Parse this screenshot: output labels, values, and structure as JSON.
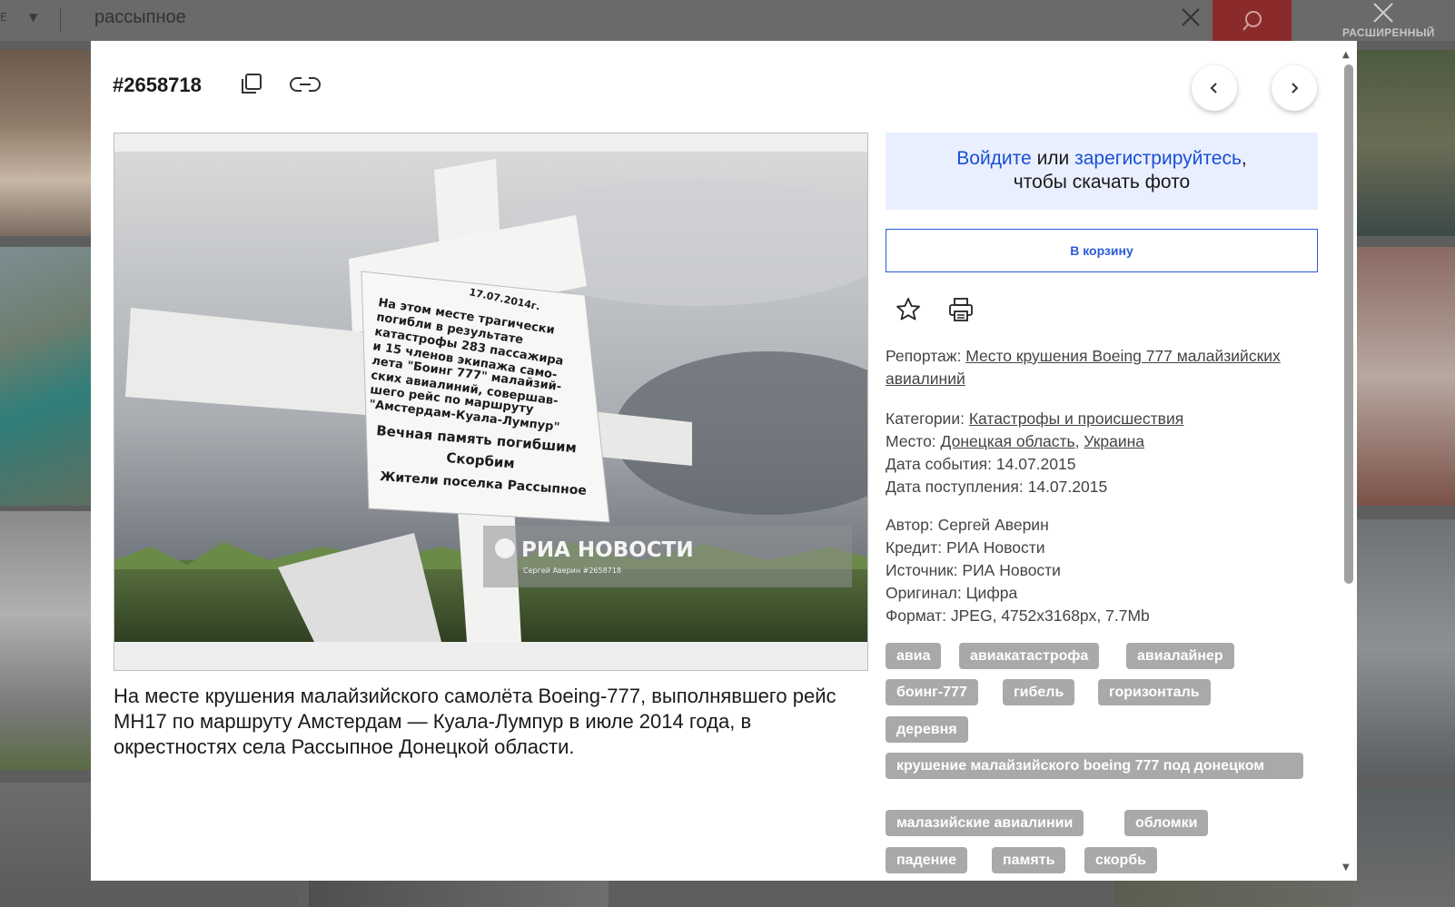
{
  "search": {
    "scope_label": "E",
    "scope_arrow": "▼",
    "query": "рассыпное",
    "clear_icon": "close-icon",
    "search_icon": "search-icon",
    "advanced_label": "РАСШИРЕННЫЙ"
  },
  "modal": {
    "photo_id": "#2658718",
    "caption": "На месте крушения малайзийского самолёта Boeing-777, выполнявшего рейс MH17 по маршруту Амстердам — Куала-Лумпур в июле 2014 года, в окрестностях села Рассыпное Донецкой области.",
    "photo": {
      "watermark_brand": "РИА НОВОСТИ",
      "watermark_credit": "Сергей Аверин #2658718",
      "plaque_lines": [
        "На этом месте трагически",
        "погибли в результате",
        "катастрофы 283 пассажира",
        "и 15 членов экипажа само-",
        "лета \"Боинг 777\" малайзий-",
        "ских авиалиний, совершав-",
        "шего рейс по маршруту",
        "\"Амстердам-Куала-Лумпур\"",
        "Вечная память погибшим",
        "Скорбим",
        "Жители поселка Рассыпное"
      ],
      "plaque_date": "17.07.2014г."
    },
    "login": {
      "login_link": "Войдите",
      "or": " или ",
      "register_link": "зарегистрируйтесь",
      "comma": ",",
      "suffix": "чтобы скачать фото"
    },
    "cart_button": "В корзину",
    "report_label": "Репортаж: ",
    "report_link": "Место крушения Boeing 777 малайзийских авиалиний",
    "categories_label": "Категории: ",
    "categories_link": "Катастрофы и происшествия",
    "place_label": "Место: ",
    "place_link_1": "Донецкая область",
    "place_sep": ", ",
    "place_link_2": "Украина",
    "event_date": "Дата события: 14.07.2015",
    "received_date": "Дата поступления: 14.07.2015",
    "author": "Автор: Сергей Аверин",
    "credit": "Кредит: РИА Новости",
    "source": "Источник: РИА Новости",
    "original": "Оригинал: Цифра",
    "format": "Формат: JPEG, 4752x3168px, 7.7Mb",
    "tags": [
      "авиа",
      "авиакатастрофа",
      "авиалайнер",
      "боинг-777",
      "гибель",
      "горизонталь",
      "деревня",
      "крушение малайзийского boeing 777 под донецком",
      "малазийские авиалинии",
      "обломки",
      "падение",
      "память",
      "скорбь"
    ]
  },
  "colors": {
    "accent_blue": "#2a5bd7",
    "link_blue": "#1a4fd6",
    "login_bg": "#e9efff",
    "tag_bg": "#a9a9a9",
    "search_button": "#8b2a2a"
  }
}
